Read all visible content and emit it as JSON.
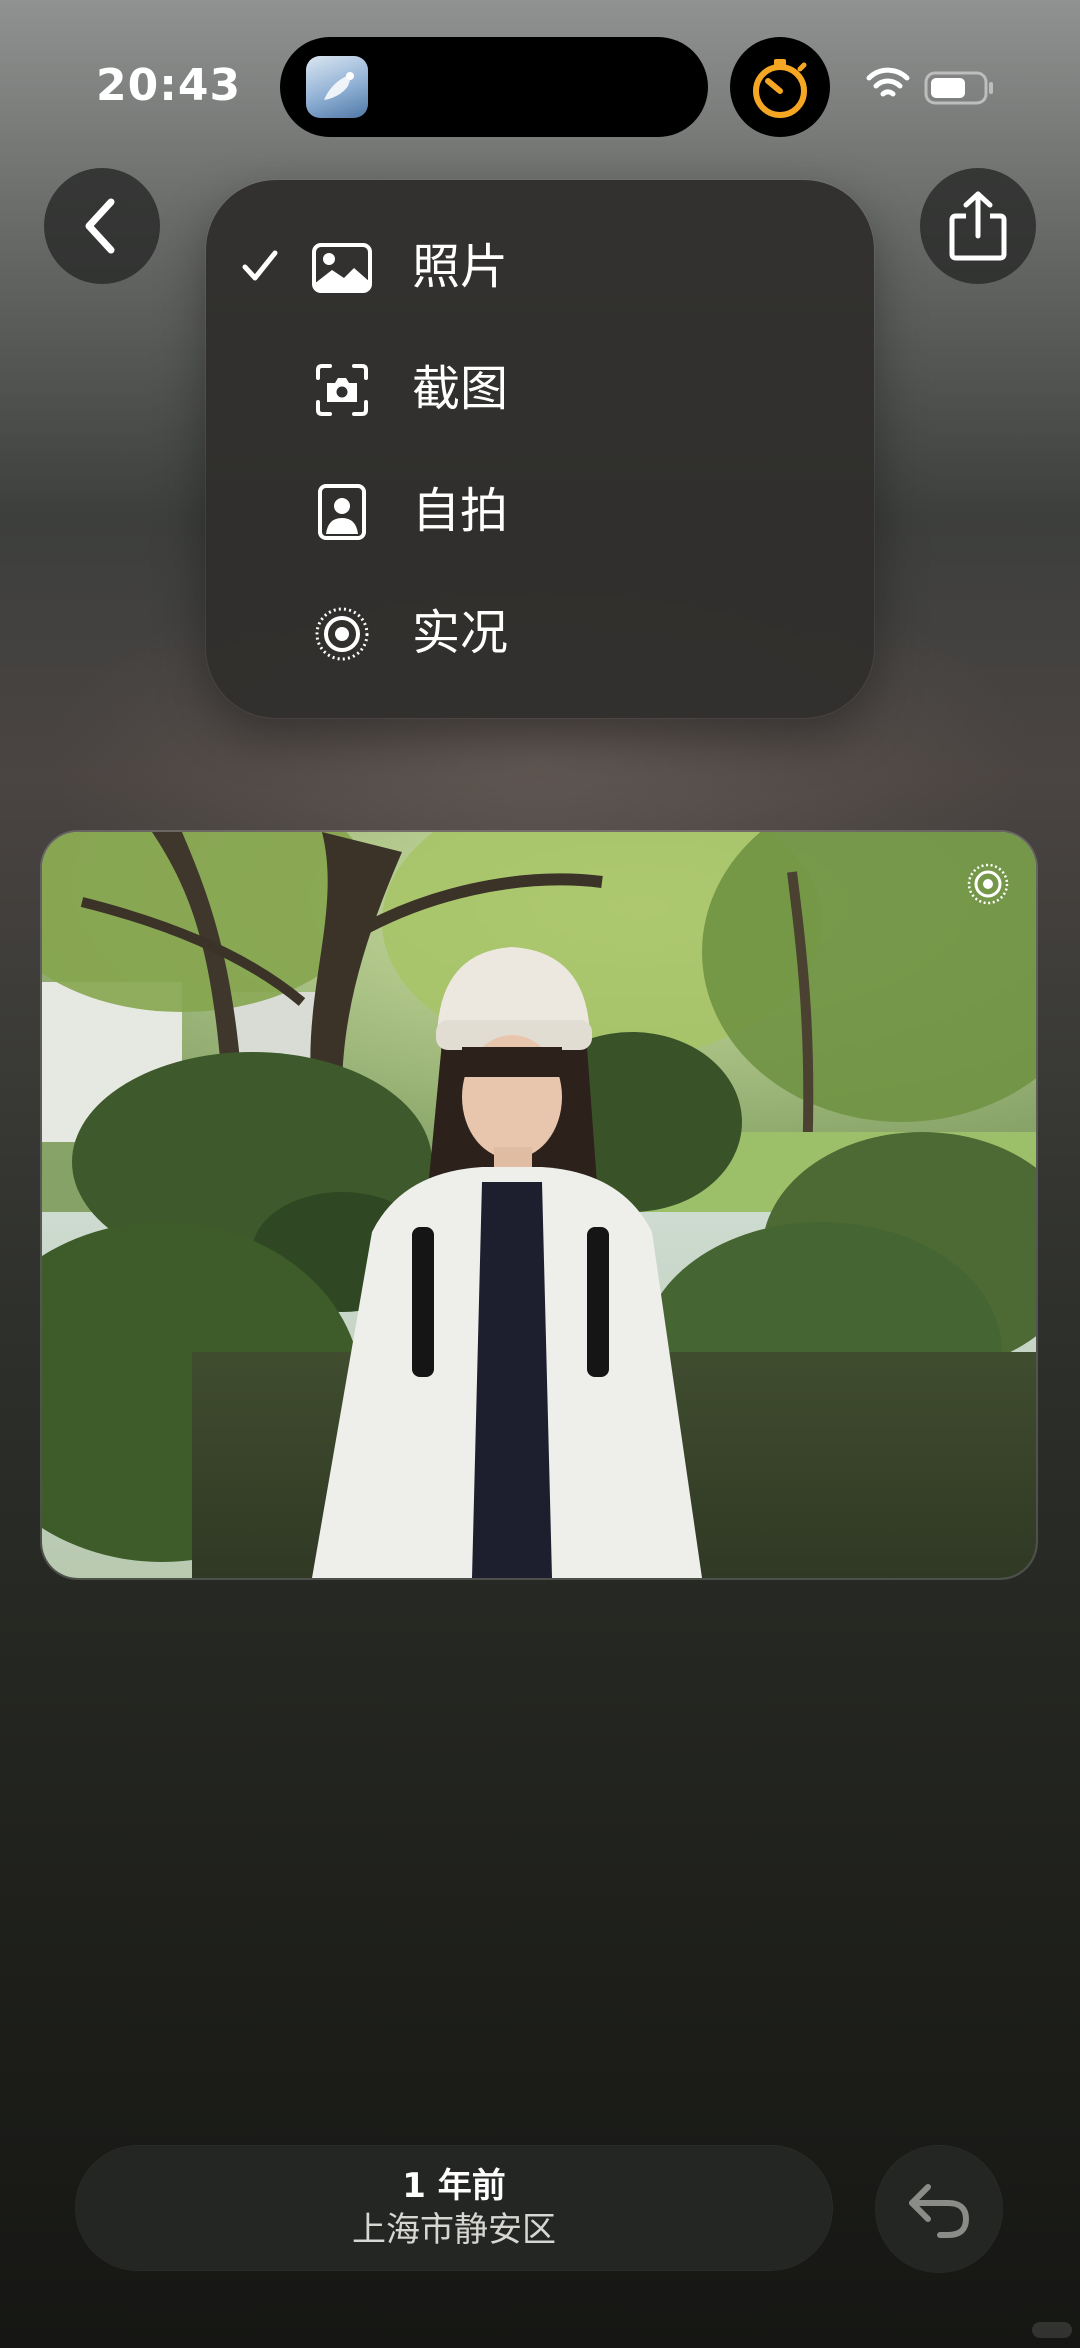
{
  "status_bar": {
    "time": "20:43",
    "wifi_icon": "wifi-icon",
    "battery_icon": "battery-icon",
    "timer_icon": "timer-icon",
    "timer_color": "#f5a623"
  },
  "header": {
    "back_icon": "chevron-left-icon",
    "share_icon": "share-icon"
  },
  "menu": {
    "items": [
      {
        "label": "照片",
        "icon": "photo-icon",
        "selected": true
      },
      {
        "label": "截图",
        "icon": "screenshot-icon",
        "selected": false
      },
      {
        "label": "自拍",
        "icon": "selfie-icon",
        "selected": false
      },
      {
        "label": "实况",
        "icon": "live-photo-icon",
        "selected": false
      }
    ]
  },
  "photo": {
    "badge_icon": "live-photo-icon"
  },
  "info": {
    "time_ago": "1 年前",
    "location": "上海市静安区"
  },
  "revert_icon": "undo-arrow-icon"
}
